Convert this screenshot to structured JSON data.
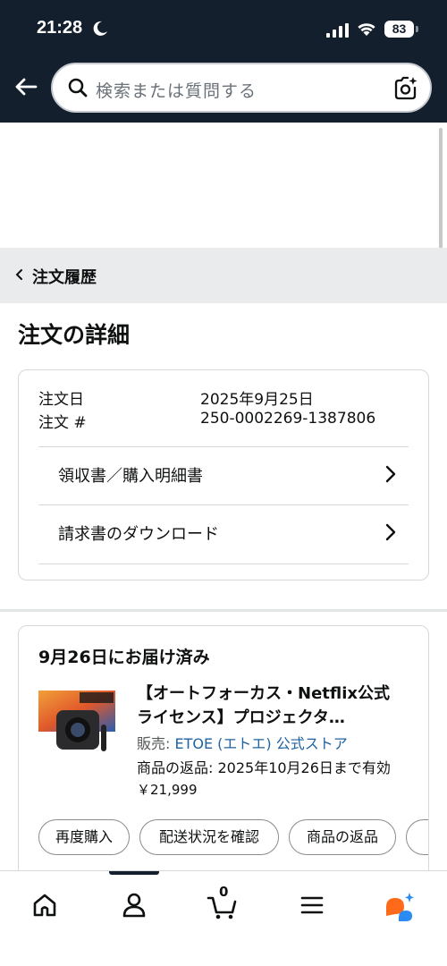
{
  "status_bar": {
    "time": "21:28",
    "battery": "83"
  },
  "search": {
    "placeholder": "検索または質問する"
  },
  "breadcrumb": {
    "label": "注文履歴"
  },
  "page": {
    "title": "注文の詳細"
  },
  "order_info": {
    "date_label": "注文日",
    "date_value": "2025年9月25日",
    "number_label": "注文 #",
    "number_value": "250-0002269-1387806",
    "receipt_link": "領収書／購入明細書",
    "invoice_link": "請求書のダウンロード"
  },
  "shipment": {
    "status": "9月26日にお届け済み",
    "product_title": "【オートフォーカス・Netflix公式ライセンス】プロジェクタ…",
    "seller_label": "販売: ",
    "seller_name": "ETOE (エトエ) 公式ストア",
    "return_text": "商品の返品: 2025年10月26日まで有効",
    "price": "￥21,999",
    "buttons": [
      "再度購入",
      "配送状況を確認",
      "商品の返品"
    ]
  },
  "bottom_nav": {
    "items": [
      "home-icon",
      "account-icon",
      "cart-icon",
      "menu-icon",
      "rufus-icon"
    ],
    "cart_count": "0"
  },
  "colors": {
    "header": "#141f2e",
    "link": "#2162a1",
    "crumb_bg": "#e9ebed",
    "rufus_orange": "#ff6a1a",
    "rufus_blue": "#2a8bf2"
  }
}
